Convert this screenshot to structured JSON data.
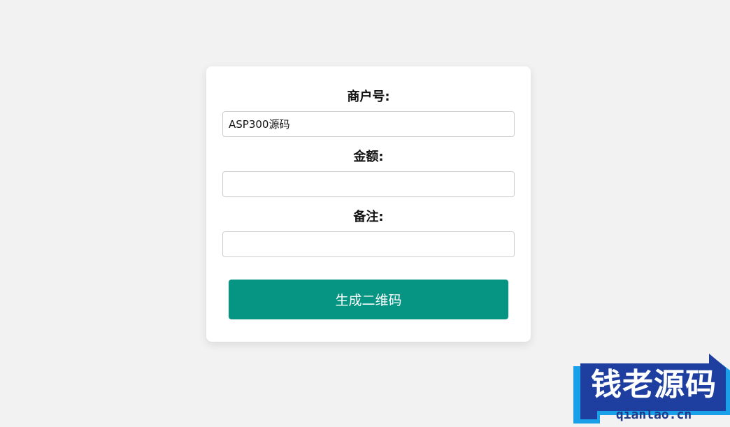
{
  "form": {
    "merchant_label": "商户号:",
    "merchant_value": "ASP300源码",
    "amount_label": "金额:",
    "amount_value": "",
    "remark_label": "备注:",
    "remark_value": "",
    "submit_label": "生成二维码"
  },
  "watermark": {
    "title": "钱老源码",
    "url": "qianlao.cn"
  },
  "colors": {
    "page_background": "#f2f2f2",
    "button": "#069583",
    "watermark_blue": "#1e3fa0",
    "watermark_accent": "#1aa0e8"
  }
}
